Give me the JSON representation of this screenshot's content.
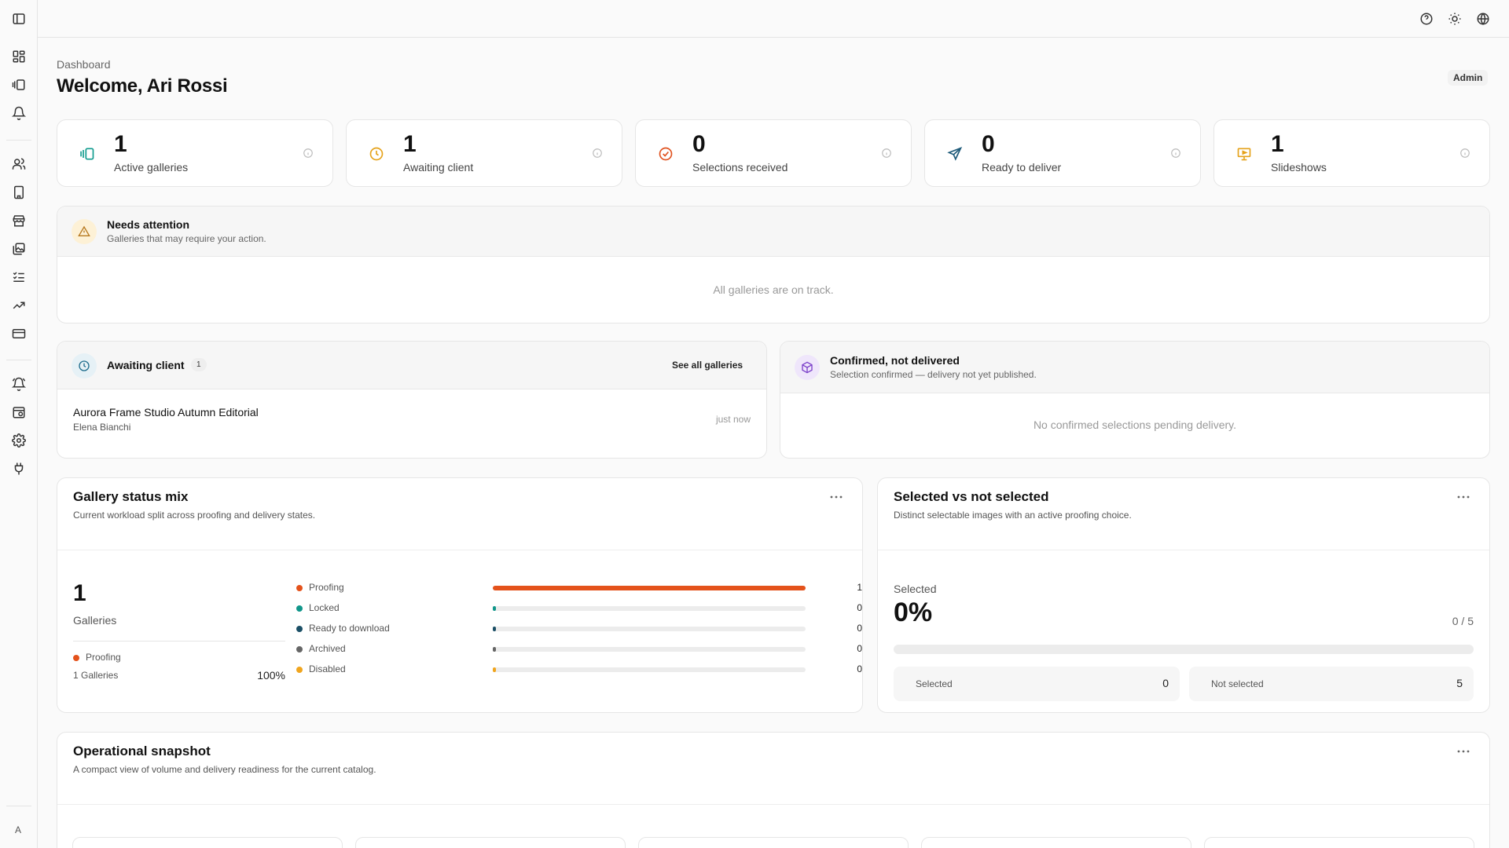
{
  "breadcrumb": "Dashboard",
  "title": "Welcome, Ari Rossi",
  "role": "Admin",
  "user_initial": "A",
  "stats": [
    {
      "value": "1",
      "label": "Active galleries",
      "icon": "gallery-icon",
      "color": "#0f9b8e"
    },
    {
      "value": "1",
      "label": "Awaiting client",
      "icon": "clock-icon",
      "color": "#e5a21a"
    },
    {
      "value": "0",
      "label": "Selections received",
      "icon": "check-circle-icon",
      "color": "#e0521f"
    },
    {
      "value": "0",
      "label": "Ready to deliver",
      "icon": "send-icon",
      "color": "#1e5b7a"
    },
    {
      "value": "1",
      "label": "Slideshows",
      "icon": "presentation-icon",
      "color": "#e5a21a"
    }
  ],
  "attention": {
    "title": "Needs attention",
    "subtitle": "Galleries that may require your action.",
    "empty": "All galleries are on track."
  },
  "awaiting": {
    "title": "Awaiting client",
    "count": "1",
    "link": "See all galleries",
    "items": [
      {
        "name": "Aurora Frame Studio Autumn Editorial",
        "client": "Elena Bianchi",
        "time": "just now"
      }
    ]
  },
  "confirmed": {
    "title": "Confirmed, not delivered",
    "subtitle": "Selection confirmed — delivery not yet published.",
    "empty": "No confirmed selections pending delivery."
  },
  "status_mix": {
    "title": "Gallery status mix",
    "subtitle": "Current workload split across proofing and delivery states.",
    "total": "1",
    "total_label": "Galleries",
    "top_label": "Proofing",
    "top_count": "1 Galleries",
    "top_pct": "100%",
    "rows": [
      {
        "label": "Proofing",
        "count": "1",
        "fraction": 1.0,
        "color": "#e4521b"
      },
      {
        "label": "Locked",
        "count": "0",
        "fraction": 0,
        "color": "#10968a"
      },
      {
        "label": "Ready to download",
        "count": "0",
        "fraction": 0,
        "color": "#1b4f66"
      },
      {
        "label": "Archived",
        "count": "0",
        "fraction": 0,
        "color": "#666666"
      },
      {
        "label": "Disabled",
        "count": "0",
        "fraction": 0,
        "color": "#f0a51e"
      }
    ]
  },
  "selected": {
    "title": "Selected vs not selected",
    "subtitle": "Distinct selectable images with an active proofing choice.",
    "label": "Selected",
    "percent": "0%",
    "ratio": "0 / 5",
    "fraction": 0,
    "selected_label": "Selected",
    "selected_value": "0",
    "not_selected_label": "Not selected",
    "not_selected_value": "5"
  },
  "snapshot": {
    "title": "Operational snapshot",
    "subtitle": "A compact view of volume and delivery readiness for the current catalog."
  }
}
